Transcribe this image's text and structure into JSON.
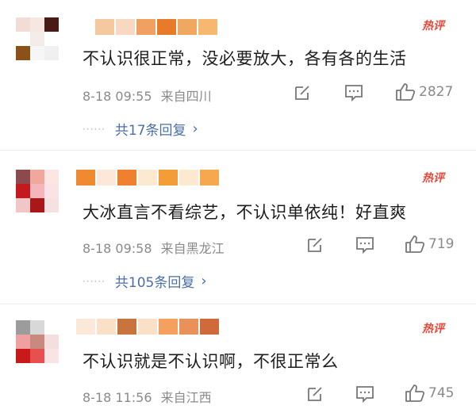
{
  "hot_label": "热评",
  "comments": [
    {
      "text": "不认识很正常，没必要放大，各有各的生活",
      "time": "8-18 09:55",
      "location": "来自四川",
      "likes": "2827",
      "replies_label": "共17条回复",
      "avatar_colors": [
        "#f4dcd6",
        "#f8e6e2",
        "#4a1a14",
        "#ffffff",
        "#f4ece8",
        "#ffffff",
        "#8a5218",
        "#f6f6f6",
        "#f0f0f0"
      ],
      "name_colors": [
        "#f6c8a0",
        "#f8d8c0",
        "#f0a060",
        "#e87a2a",
        "#f0a860",
        "#f6b870"
      ]
    },
    {
      "text": "大冰直言不看综艺，不认识单依纯！好直爽",
      "time": "8-18 09:58",
      "location": "来自黑龙江",
      "likes": "719",
      "replies_label": "共105条回复",
      "avatar_colors": [
        "#8a4a4e",
        "#f0a89c",
        "#fbe6e2",
        "#c41a1e",
        "#f4b6ba",
        "#fbe2e4",
        "#f0c6c6",
        "#a81818",
        "#f6e0e0"
      ],
      "name_colors": [
        "#f08a30",
        "#fce8d8",
        "#f08030",
        "#fde8d0",
        "#f39c38",
        "#fde8d0",
        "#f6a850"
      ]
    },
    {
      "text": "不认识就是不认识啊，不很正常么",
      "time": "8-18 11:56",
      "location": "来自江西",
      "likes": "745",
      "avatar_colors": [
        "#9c9c9c",
        "#d8d8d8",
        "#ffffff",
        "#f0a0a0",
        "#c88a80",
        "#f4dede",
        "#c81a1a",
        "#e85050",
        "#f8e4e4"
      ],
      "name_colors": [
        "#fbe8d8",
        "#fbe0c8",
        "#c8743c",
        "#fbe0c8",
        "#f6a060",
        "#e8925a",
        "#d06a3a"
      ]
    }
  ]
}
